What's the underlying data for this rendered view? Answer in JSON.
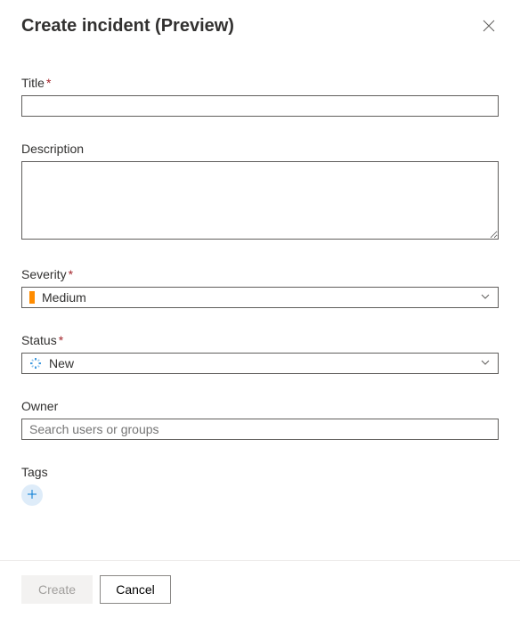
{
  "header": {
    "title": "Create incident (Preview)"
  },
  "fields": {
    "title": {
      "label": "Title",
      "required_mark": "*",
      "value": ""
    },
    "description": {
      "label": "Description",
      "value": ""
    },
    "severity": {
      "label": "Severity",
      "required_mark": "*",
      "selected": "Medium",
      "color": "#ff8c00"
    },
    "status": {
      "label": "Status",
      "required_mark": "*",
      "selected": "New"
    },
    "owner": {
      "label": "Owner",
      "placeholder": "Search users or groups",
      "value": ""
    },
    "tags": {
      "label": "Tags"
    }
  },
  "footer": {
    "create_label": "Create",
    "cancel_label": "Cancel"
  }
}
